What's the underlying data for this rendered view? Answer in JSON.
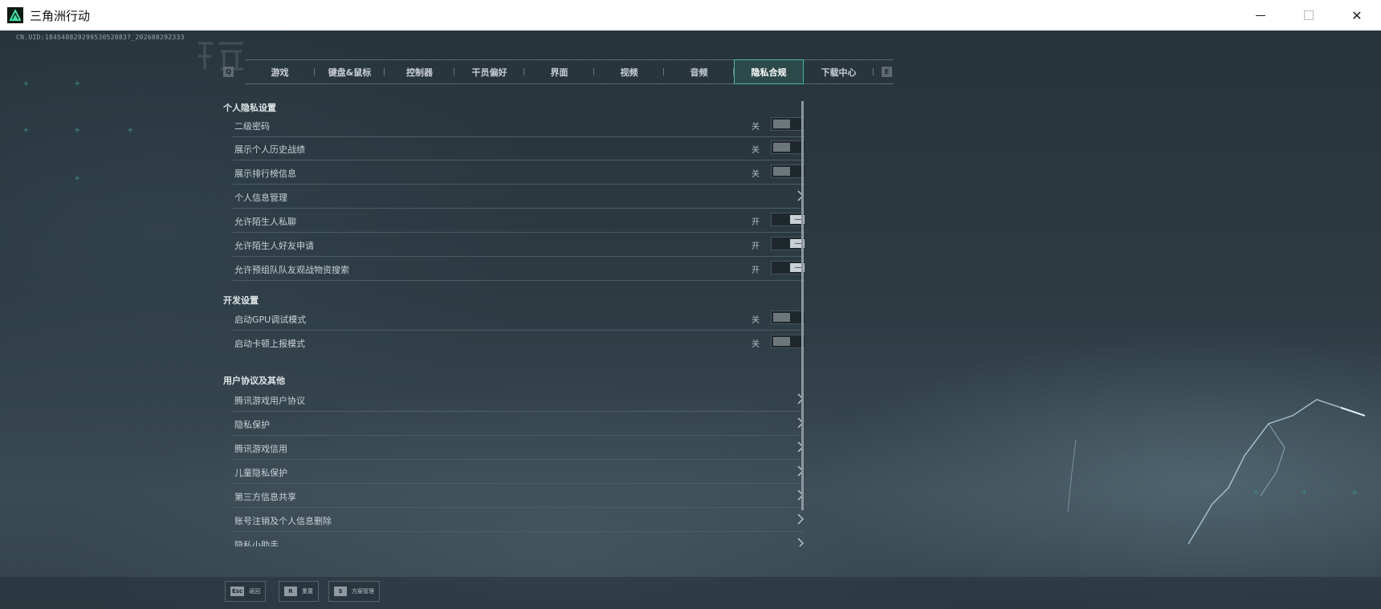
{
  "window": {
    "title": "三角洲行动",
    "controls": {
      "minimize": "minimize-icon",
      "maximize": "maximize-icon",
      "close": "✕"
    }
  },
  "uid_text": "CN.UID:18454882929953052083?_202608292333",
  "tabs": {
    "left_key": "Q",
    "right_key": "E",
    "items": [
      {
        "label": "游戏"
      },
      {
        "label": "键盘&鼠标"
      },
      {
        "label": "控制器"
      },
      {
        "label": "干员偏好"
      },
      {
        "label": "界面"
      },
      {
        "label": "视频"
      },
      {
        "label": "音频"
      },
      {
        "label": "隐私合规",
        "active": true
      },
      {
        "label": "下载中心"
      }
    ]
  },
  "sections": [
    {
      "title": "个人隐私设置",
      "rows": [
        {
          "label": "二级密码",
          "type": "toggle",
          "state_text": "关",
          "on": false
        },
        {
          "label": "展示个人历史战绩",
          "type": "toggle",
          "state_text": "关",
          "on": false
        },
        {
          "label": "展示排行榜信息",
          "type": "toggle",
          "state_text": "关",
          "on": false
        },
        {
          "label": "个人信息管理",
          "type": "link"
        },
        {
          "label": "允许陌生人私聊",
          "type": "toggle",
          "state_text": "开",
          "on": true
        },
        {
          "label": "允许陌生人好友申请",
          "type": "toggle",
          "state_text": "开",
          "on": true
        },
        {
          "label": "允许预组队队友观战物资搜索",
          "type": "toggle",
          "state_text": "开",
          "on": true
        }
      ]
    },
    {
      "title": "开发设置",
      "rows": [
        {
          "label": "启动GPU调试模式",
          "type": "toggle",
          "state_text": "关",
          "on": false
        },
        {
          "label": "启动卡顿上报模式",
          "type": "toggle",
          "state_text": "关",
          "on": false
        }
      ]
    },
    {
      "title": "用户协议及其他",
      "rows": [
        {
          "label": "腾讯游戏用户协议",
          "type": "link"
        },
        {
          "label": "隐私保护",
          "type": "link"
        },
        {
          "label": "腾讯游戏信用",
          "type": "link"
        },
        {
          "label": "儿童隐私保护",
          "type": "link"
        },
        {
          "label": "第三方信息共享",
          "type": "link"
        },
        {
          "label": "账号注销及个人信息删除",
          "type": "link"
        },
        {
          "label": "隐私小助手",
          "type": "link"
        }
      ]
    }
  ],
  "footer": [
    {
      "key": "Esc",
      "label": "返回"
    },
    {
      "key": "R",
      "label": "重置"
    },
    {
      "key": "S",
      "label": "方案管理"
    }
  ],
  "colors": {
    "accent": "#4bb79a",
    "panel_bg": "#27343c"
  }
}
